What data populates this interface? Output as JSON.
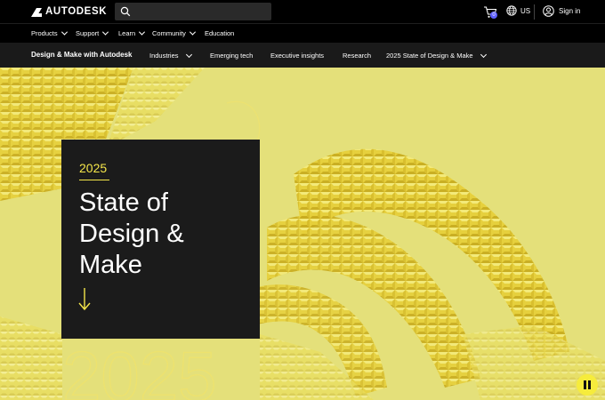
{
  "header": {
    "logo_text": "AUTODESK",
    "search_placeholder": "",
    "cart_count": "0",
    "region": "US",
    "sign_in": "Sign in"
  },
  "nav": {
    "items": [
      {
        "label": "Products",
        "dropdown": true
      },
      {
        "label": "Support",
        "dropdown": true
      },
      {
        "label": "Learn",
        "dropdown": true
      },
      {
        "label": "Community",
        "dropdown": true
      },
      {
        "label": "Education",
        "dropdown": false
      }
    ]
  },
  "subnav": {
    "brand": "Design & Make with Autodesk",
    "items": [
      {
        "label": "Industries",
        "dropdown": true
      },
      {
        "label": "Emerging tech",
        "dropdown": false
      },
      {
        "label": "Executive insights",
        "dropdown": false
      },
      {
        "label": "Research",
        "dropdown": false
      },
      {
        "label": "2025 State of Design & Make",
        "dropdown": true
      }
    ]
  },
  "hero": {
    "year": "2025",
    "title": "State of Design & Make",
    "background_color": "#e4e07a",
    "accent_color": "#f4e54a",
    "card_color": "#1b1b1b"
  },
  "icons": {
    "cart": "cart-icon",
    "globe": "globe-icon",
    "user": "user-circle-icon",
    "search": "search-icon",
    "arrow": "arrow-down-icon",
    "pause": "pause-icon"
  }
}
